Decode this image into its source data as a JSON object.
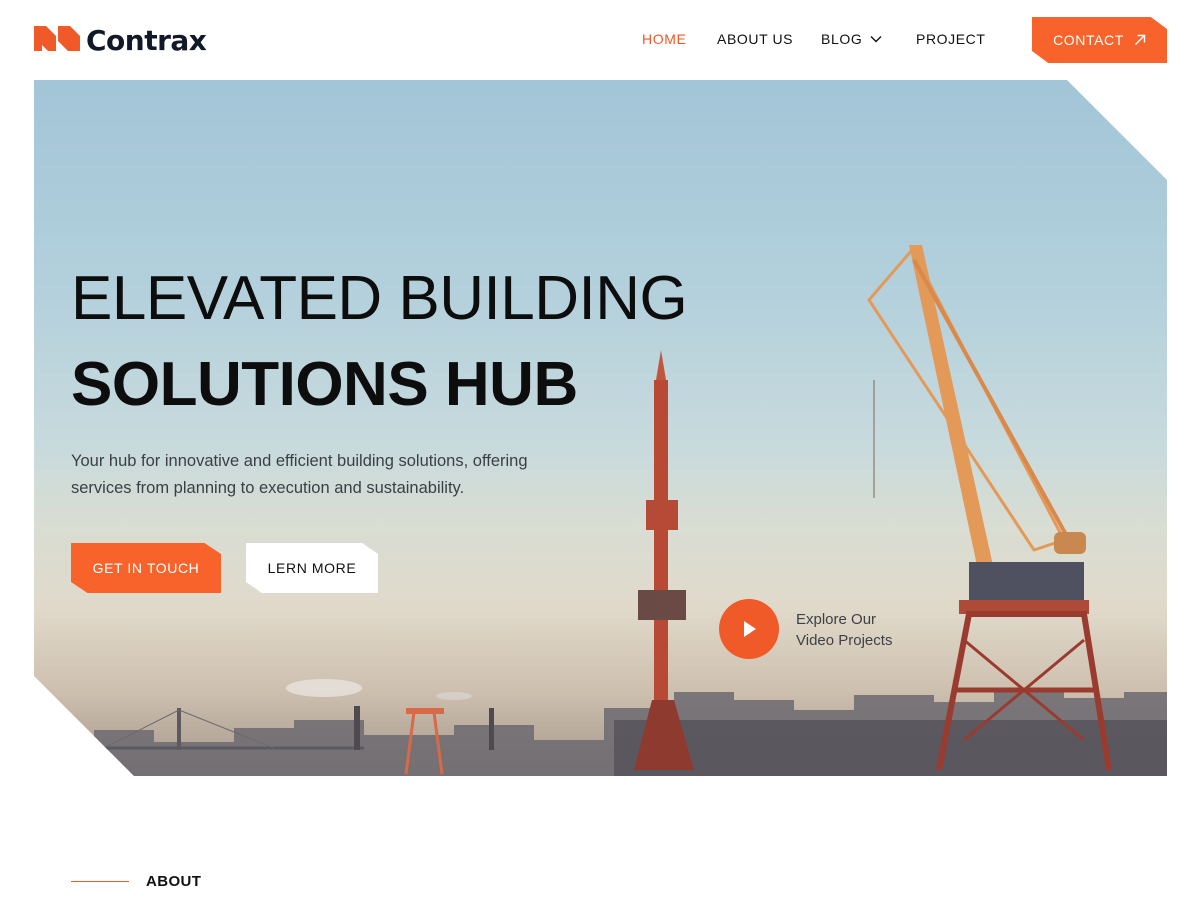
{
  "brand": {
    "name": "Contrax",
    "accent": "#f7632b"
  },
  "nav": {
    "items": [
      {
        "label": "HOME",
        "active": true
      },
      {
        "label": "ABOUT US",
        "active": false
      },
      {
        "label": "BLOG",
        "active": false,
        "has_dropdown": true
      },
      {
        "label": "PROJECT",
        "active": false
      }
    ],
    "contact_label": "CONTACT"
  },
  "hero": {
    "title_line1": "ELEVATED BUILDING",
    "title_line2": "SOLUTIONS HUB",
    "description": "Your hub for innovative and efficient building solutions, offering services from planning to execution and sustainability.",
    "primary_button": "GET IN TOUCH",
    "secondary_button": "LERN MORE",
    "video_label_line1": "Explore Our",
    "video_label_line2": "Video Projects"
  },
  "about": {
    "label": "ABOUT"
  },
  "icons": {
    "logo": "logo-mark-icon",
    "dropdown": "chevron-down-icon",
    "contact": "arrow-up-right-icon",
    "video": "play-icon"
  }
}
